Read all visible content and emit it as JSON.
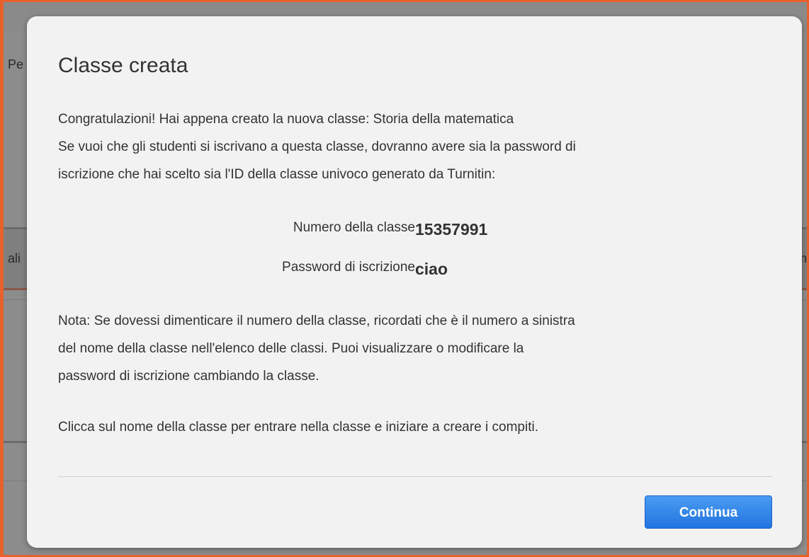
{
  "background": {
    "left_fragments": [
      "Pe",
      "ali"
    ],
    "right_fragments": [
      "m"
    ]
  },
  "dialog": {
    "title": "Classe creata",
    "intro_lines": [
      "Congratulazioni! Hai appena creato la nuova classe: Storia della matematica",
      "Se vuoi che gli studenti si iscrivano a questa classe, dovranno avere sia la password di",
      "iscrizione che hai scelto sia l'ID della classe univoco generato da Turnitin:"
    ],
    "class_number": {
      "label": "Numero della classe",
      "value": "15357991"
    },
    "enrollment_password": {
      "label": "Password di iscrizione",
      "value": "ciao"
    },
    "note_lines": [
      "Nota: Se dovessi dimenticare il numero della classe, ricordati che è il numero a sinistra",
      "del nome della classe nell'elenco delle classi. Puoi visualizzare o modificare la",
      "password di iscrizione cambiando la classe."
    ],
    "hint": "Clicca sul nome della classe per entrare nella classe e iniziare a creare i compiti.",
    "continue_label": "Continua"
  },
  "colors": {
    "frame_border": "#e8612c",
    "button_primary": "#2274e0",
    "overlay": "#8c8c8c"
  }
}
